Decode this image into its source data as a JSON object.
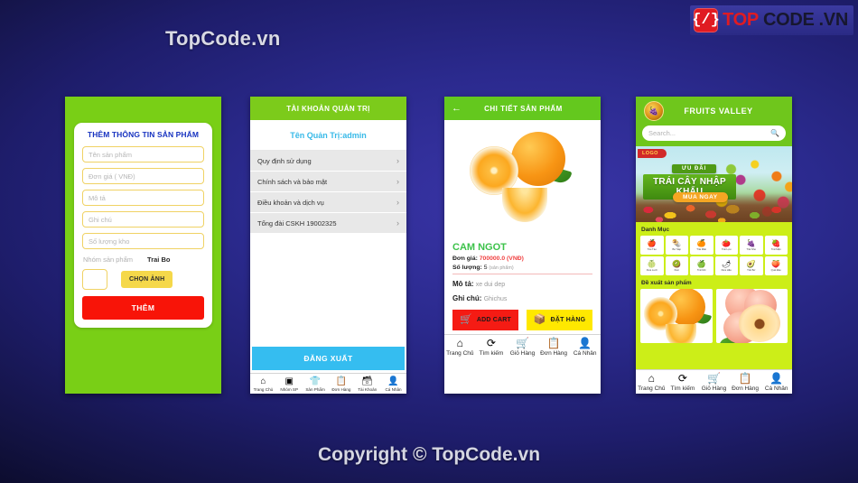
{
  "page": {
    "title": "TopCode.vn",
    "copyright": "Copyright © TopCode.vn",
    "logo": {
      "mark": "{/}",
      "top": "TOP",
      "code": "CODE",
      "vn": ".VN"
    },
    "colors": {
      "bg_center": "#3a35a8",
      "bg_edge": "#030310",
      "green_header": "#7ccb1b",
      "accent_yellow": "#ffe800",
      "accent_red": "#f51b14",
      "accent_cyan": "#35bdf0",
      "lime": "#ccee18"
    }
  },
  "screen1": {
    "title": "THÊM THÔNG TIN SẢN PHẨM",
    "fields": [
      {
        "placeholder": "Tên sản phẩm",
        "value": ""
      },
      {
        "placeholder": "Đơn giá ( VNĐ)",
        "value": ""
      },
      {
        "placeholder": "Mô tả",
        "value": ""
      },
      {
        "placeholder": "Ghi chú",
        "value": ""
      },
      {
        "placeholder": "Số lượng kho",
        "value": ""
      }
    ],
    "group_label": "Nhóm sản phẩm",
    "group_value": "Trai Bo",
    "pick_image_button": "CHỌN ẢNH",
    "submit_button": "THÊM"
  },
  "screen2": {
    "header": "TÀI KHOẢN QUẢN TRỊ",
    "account_label": "Tên Quản Trị:admin",
    "items": [
      {
        "label": "Quy định sử dụng",
        "chevron": "›"
      },
      {
        "label": "Chính sách và bảo mật",
        "chevron": "›"
      },
      {
        "label": "Điều khoản và dịch vụ",
        "chevron": "›"
      },
      {
        "label": "Tổng đài CSKH 19002325",
        "chevron": "›"
      }
    ],
    "logout_button": "ĐĂNG XUẤT",
    "nav": [
      {
        "icon": "home-icon",
        "glyph": "⌂",
        "label": "Trang Chủ"
      },
      {
        "icon": "folder-icon",
        "glyph": "▣",
        "label": "Nhóm SP"
      },
      {
        "icon": "shirt-icon",
        "glyph": "ὅ5",
        "label": "Sản Phẩm"
      },
      {
        "icon": "orders-icon",
        "glyph": "ὌB",
        "label": "Đơn Hàng"
      },
      {
        "icon": "account-icon",
        "glyph": "὜B",
        "label": "Tài Khoản"
      },
      {
        "icon": "person-icon",
        "glyph": "὆4",
        "label": "Cá Nhân"
      }
    ]
  },
  "screen3": {
    "back_icon": "←",
    "header": "CHI TIẾT SẢN PHẨM",
    "product_name": "CAM NGOT",
    "price_label": "Đơn giá:",
    "price_value": "700000.0",
    "price_currency": "(VNĐ)",
    "qty_label": "Số lượng:",
    "qty_value": "5",
    "qty_unit": "(sản phẩm)",
    "desc_label": "Mô tả:",
    "desc_value": "xe dui dep",
    "note_label": "Ghi chú:",
    "note_value": "Ghichus",
    "add_cart_button": "ADD CART",
    "order_button": "ĐẶT HÀNG",
    "nav": [
      {
        "icon": "home-icon",
        "glyph": "⌂",
        "label": "Trang Chủ"
      },
      {
        "icon": "search-icon",
        "glyph": "⟳",
        "label": "Tìm kiếm"
      },
      {
        "icon": "cart-icon",
        "glyph": "Ὥ2",
        "label": "Giỏ Hàng"
      },
      {
        "icon": "orders-icon",
        "glyph": "ὌB",
        "label": "Đơn Hàng"
      },
      {
        "icon": "person-icon",
        "glyph": "὆4",
        "label": "Cá Nhân"
      }
    ]
  },
  "screen4": {
    "brand": "FRUITS VALLEY",
    "logo_icon": "fruit-basket-icon",
    "search_placeholder": "Search...",
    "search_icon": "search-icon",
    "banner": {
      "logo_badge": "LOGO",
      "line1": "ƯU ĐÃI",
      "line2": "TRÁI CÂY NHẬP KHẨU",
      "cta": "MUA NGAY"
    },
    "category_title": "Danh Mục",
    "categories": [
      {
        "glyph": "ἴE",
        "label": "Trái Táo"
      },
      {
        "glyph": "ἲF",
        "label": "Bơ Sáp"
      },
      {
        "glyph": "ἴA",
        "label": "Trái Măn"
      },
      {
        "glyph": "ἴ5",
        "label": "Trái Lựu"
      },
      {
        "glyph": "ἴ7",
        "label": "Trái Nho"
      },
      {
        "glyph": "ἵ3",
        "label": "Trái Mận"
      },
      {
        "glyph": "ἴ8",
        "label": "Dưa Lưới"
      },
      {
        "glyph": "ᾕD",
        "label": "Kiwi"
      },
      {
        "glyph": "ἴF",
        "label": "Trái Mơ"
      },
      {
        "glyph": "ἳ6",
        "label": "Dưa Hấu"
      },
      {
        "glyph": "ᾕ1",
        "label": "Trái Bơ"
      },
      {
        "glyph": "ἵ1",
        "label": "Quả Đào"
      }
    ],
    "suggest_title": "Đề xuất sản phẩm",
    "products": [
      {
        "art": "orange",
        "name": "Cam"
      },
      {
        "art": "peach",
        "name": "Đào"
      }
    ],
    "nav": [
      {
        "icon": "home-icon",
        "glyph": "⌂",
        "label": "Trang Chủ"
      },
      {
        "icon": "search-icon",
        "glyph": "⟳",
        "label": "Tìm kiếm"
      },
      {
        "icon": "cart-icon",
        "glyph": "Ὥ2",
        "label": "Giỏ Hàng"
      },
      {
        "icon": "orders-icon",
        "glyph": "ὌB",
        "label": "Đơn Hàng"
      },
      {
        "icon": "person-icon",
        "glyph": "὆4",
        "label": "Cá Nhân"
      }
    ]
  }
}
